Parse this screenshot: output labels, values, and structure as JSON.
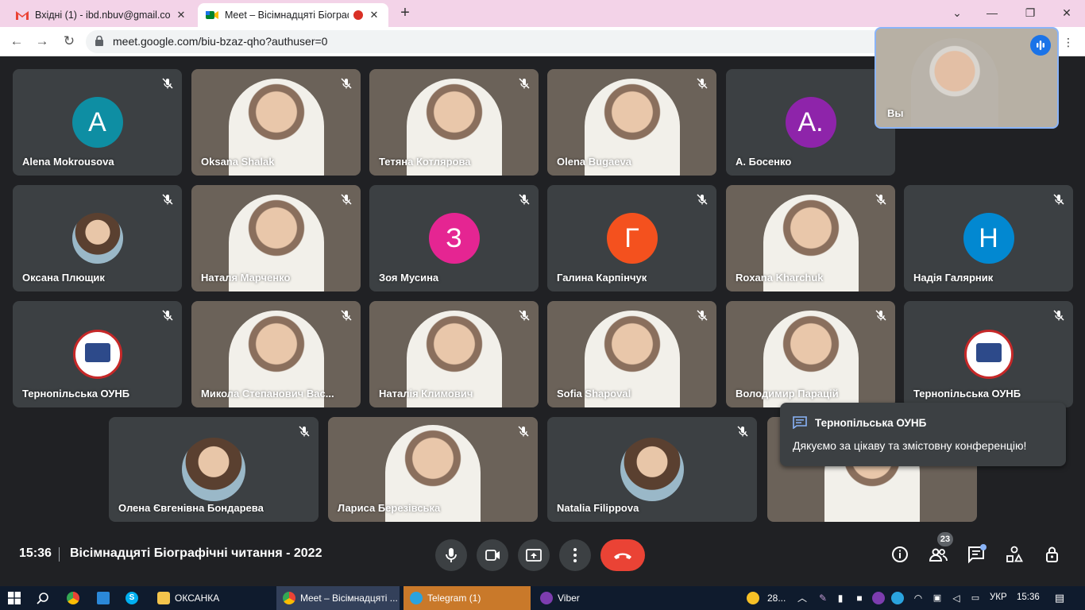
{
  "browser": {
    "tabs": [
      {
        "title": "Вхідні (1) - ibd.nbuv@gmail.com",
        "icon": "gmail-icon"
      },
      {
        "title": "Meet – Вісімнадцяті Біограф",
        "icon": "meet-icon",
        "recording": true
      }
    ],
    "new_tab": "+",
    "url": "meet.google.com/biu-bzaz-qho?authuser=0"
  },
  "participants": [
    {
      "name": "Alena Mokrousova",
      "initial": "A",
      "color": "#0e8ea3",
      "kind": "avatar"
    },
    {
      "name": "Oksana Shalak",
      "kind": "video"
    },
    {
      "name": "Тетяна Котлярова",
      "kind": "video"
    },
    {
      "name": "Olena Bugaeva",
      "kind": "video"
    },
    {
      "name": "А. Босенко",
      "initial": "A.",
      "color": "#8e24aa",
      "kind": "avatar"
    },
    {
      "name": "Оксана Плющик",
      "kind": "photo"
    },
    {
      "name": "Наталя Марченко",
      "kind": "video"
    },
    {
      "name": "Зоя Мусина",
      "initial": "З",
      "color": "#e52592",
      "kind": "avatar"
    },
    {
      "name": "Галина Карпінчук",
      "initial": "Г",
      "color": "#f4511e",
      "kind": "avatar"
    },
    {
      "name": "Roxana Kharchuk",
      "kind": "video"
    },
    {
      "name": "Надія Галярник",
      "initial": "Н",
      "color": "#0288d1",
      "kind": "avatar"
    },
    {
      "name": "Тернопільська ОУНБ",
      "kind": "emblem"
    },
    {
      "name": "Микола Степанович Вас...",
      "kind": "video"
    },
    {
      "name": "Наталія Климович",
      "kind": "video"
    },
    {
      "name": "Sofia Shapoval",
      "kind": "video"
    },
    {
      "name": "Володимир Парацій",
      "kind": "video"
    },
    {
      "name": "Тернопільська ОУНБ",
      "kind": "emblem"
    },
    {
      "name": "Олена Євгенівна Бондарева",
      "kind": "photo"
    },
    {
      "name": "Лариса Березівська",
      "kind": "video"
    },
    {
      "name": "Natalia Filippova",
      "kind": "photo"
    }
  ],
  "self_view": {
    "label": "Вы"
  },
  "chat_notification": {
    "sender": "Тернопільська ОУНБ",
    "message": "Дякуємо за цікаву та змістовну конференцію!"
  },
  "meeting": {
    "time": "15:36",
    "separator": "|",
    "title": "Вісімнадцяті Біографічні читання - 2022"
  },
  "participant_count": "23",
  "taskbar": {
    "items": [
      {
        "label": "ОКСАНКА"
      },
      {
        "label": "Meet – Вісімнадцяті ..."
      },
      {
        "label": "Telegram (1)"
      },
      {
        "label": "Viber"
      }
    ],
    "temperature": "28...",
    "language": "УКР",
    "time": "15:36"
  },
  "colors": {
    "accent": "#1a73e8",
    "hangup": "#ea4335",
    "stage": "#202124",
    "tile": "#3c4043"
  }
}
